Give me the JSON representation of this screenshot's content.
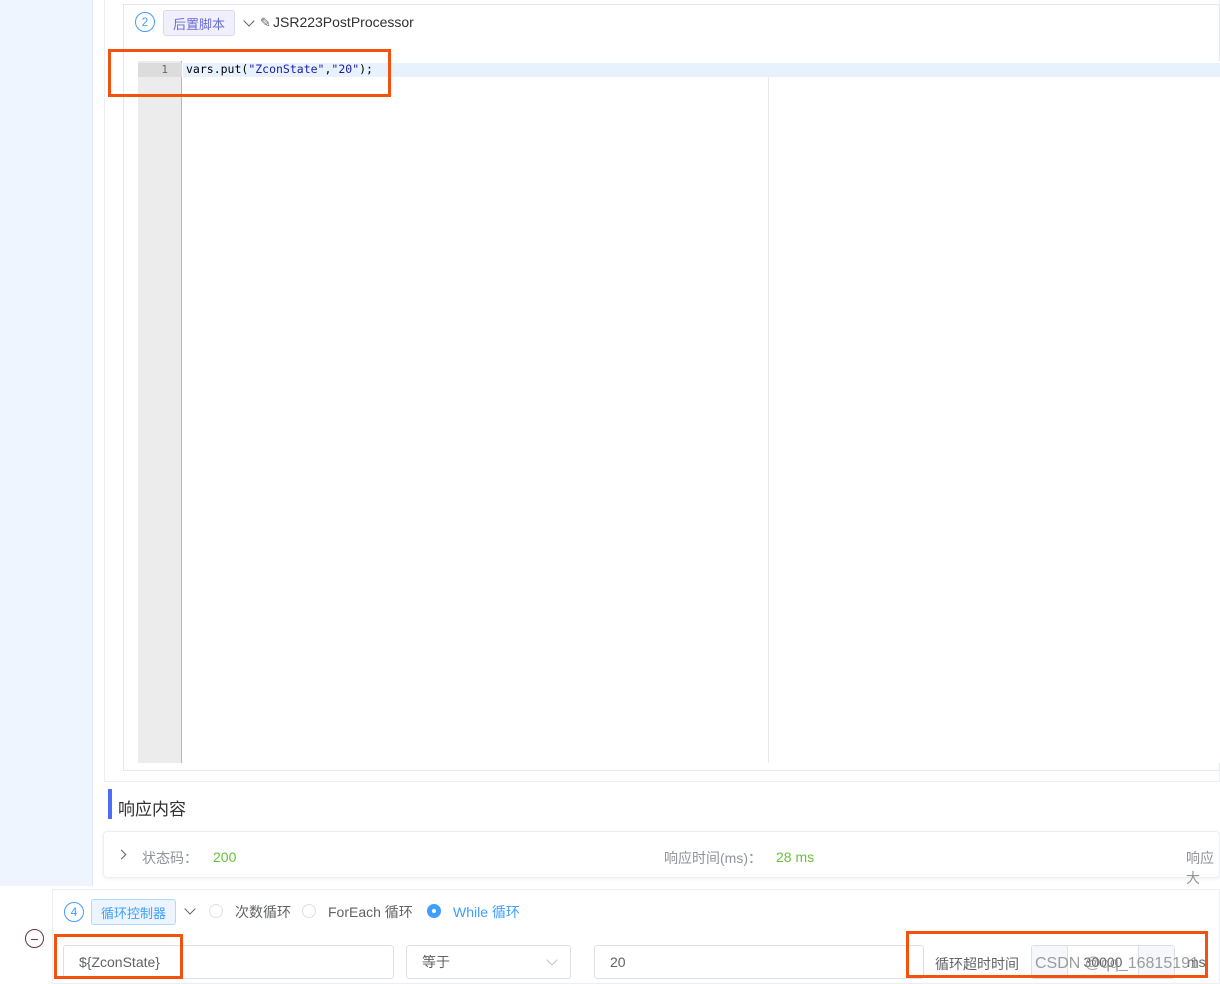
{
  "processor": {
    "step": "2",
    "tag": "后置脚本",
    "name": "JSR223PostProcessor"
  },
  "editor": {
    "line_number": "1",
    "code_prefix": "vars.put(",
    "code_arg1": "\"ZconState\"",
    "code_comma": ",",
    "code_arg2": "\"20\"",
    "code_suffix": ");"
  },
  "response": {
    "title": "响应内容",
    "status_label": "状态码：",
    "status_value": "200",
    "time_label": "响应时间(ms)：",
    "time_value": "28 ms",
    "size_label": "响应大"
  },
  "loop": {
    "step": "4",
    "tag": "循环控制器",
    "options": [
      "次数循环",
      "ForEach 循环",
      "While 循环"
    ],
    "selected_option": "While 循环",
    "variable": "${ZconState}",
    "operator": "等于",
    "value": "20",
    "timeout_label": "循环超时时间",
    "timeout_value": "30000",
    "timeout_unit": "ms"
  },
  "watermark": "CSDN @qq_16815191",
  "colors": {
    "accent": "#409eff",
    "highlight": "#f2520d",
    "success": "#67c23a"
  }
}
